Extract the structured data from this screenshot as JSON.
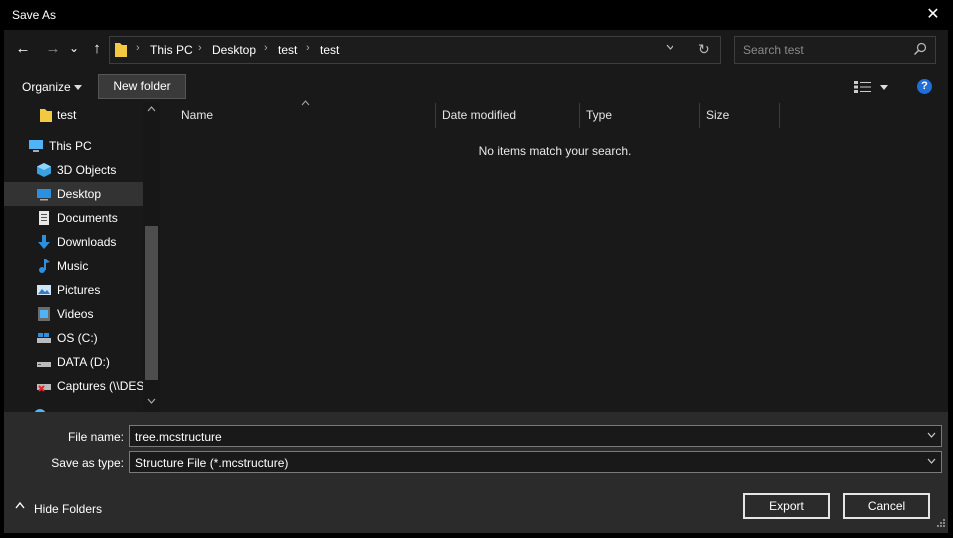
{
  "window": {
    "title": "Save As",
    "close_glyph": "✕"
  },
  "nav": {
    "back_glyph": "←",
    "forward_glyph": "→",
    "recent_glyph": "⌄",
    "up_glyph": "↑"
  },
  "address": {
    "crumbs": [
      "This PC",
      "Desktop",
      "test",
      "test"
    ],
    "separator": "›",
    "refresh_glyph": "↻"
  },
  "search": {
    "placeholder": "Search test"
  },
  "toolbar": {
    "organize": "Organize",
    "new_folder": "New folder",
    "help": "?"
  },
  "sidebar": {
    "items": [
      {
        "label": "test",
        "icon": "folder-icon"
      },
      {
        "label": "This PC",
        "icon": "computer-icon"
      },
      {
        "label": "3D Objects",
        "icon": "cube-icon"
      },
      {
        "label": "Desktop",
        "icon": "desktop-icon",
        "selected": true
      },
      {
        "label": "Documents",
        "icon": "document-icon"
      },
      {
        "label": "Downloads",
        "icon": "download-icon"
      },
      {
        "label": "Music",
        "icon": "music-icon"
      },
      {
        "label": "Pictures",
        "icon": "pictures-icon"
      },
      {
        "label": "Videos",
        "icon": "video-icon"
      },
      {
        "label": "OS (C:)",
        "icon": "drive-icon"
      },
      {
        "label": "DATA (D:)",
        "icon": "drive-icon"
      },
      {
        "label": "Captures (\\\\DESI",
        "icon": "network-drive-icon"
      }
    ]
  },
  "filelist": {
    "columns": [
      "Name",
      "Date modified",
      "Type",
      "Size"
    ],
    "empty_message": "No items match your search."
  },
  "form": {
    "file_name_label": "File name:",
    "file_name_value": "tree.mcstructure",
    "save_type_label": "Save as type:",
    "save_type_value": "Structure File (*.mcstructure)"
  },
  "footer": {
    "hide_folders": "Hide Folders",
    "hide_arrow": "▲",
    "export": "Export",
    "cancel": "Cancel"
  },
  "colors": {
    "accent": "#1f6fd6",
    "selected_bg": "#333333",
    "folder": "#f3c843"
  }
}
